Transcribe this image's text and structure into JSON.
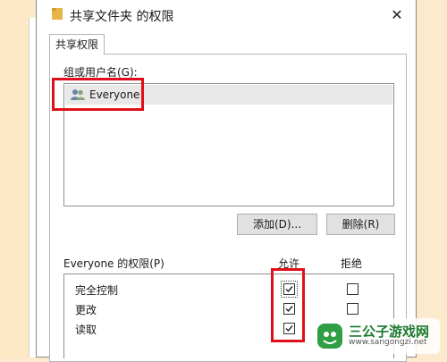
{
  "dialog": {
    "title": "共享文件夹 的权限",
    "close_glyph": "✕"
  },
  "tabs": [
    {
      "label": "共享权限"
    }
  ],
  "groups": {
    "label": "组或用户名(G):",
    "items": [
      {
        "name": "Everyone",
        "icon": "users-icon"
      }
    ]
  },
  "buttons": {
    "add_label": "添加(D)...",
    "remove_label": "删除(R)"
  },
  "permissions": {
    "label": "Everyone 的权限(P)",
    "allow_header": "允许",
    "deny_header": "拒绝",
    "rows": [
      {
        "name": "完全控制",
        "allow": true,
        "deny": false
      },
      {
        "name": "更改",
        "allow": true,
        "deny": false
      },
      {
        "name": "读取",
        "allow": true,
        "deny": false
      }
    ]
  },
  "highlight_color": "#e0101a",
  "watermark": {
    "title": "三公子游戏网",
    "url": "www.sangongzi.net"
  }
}
